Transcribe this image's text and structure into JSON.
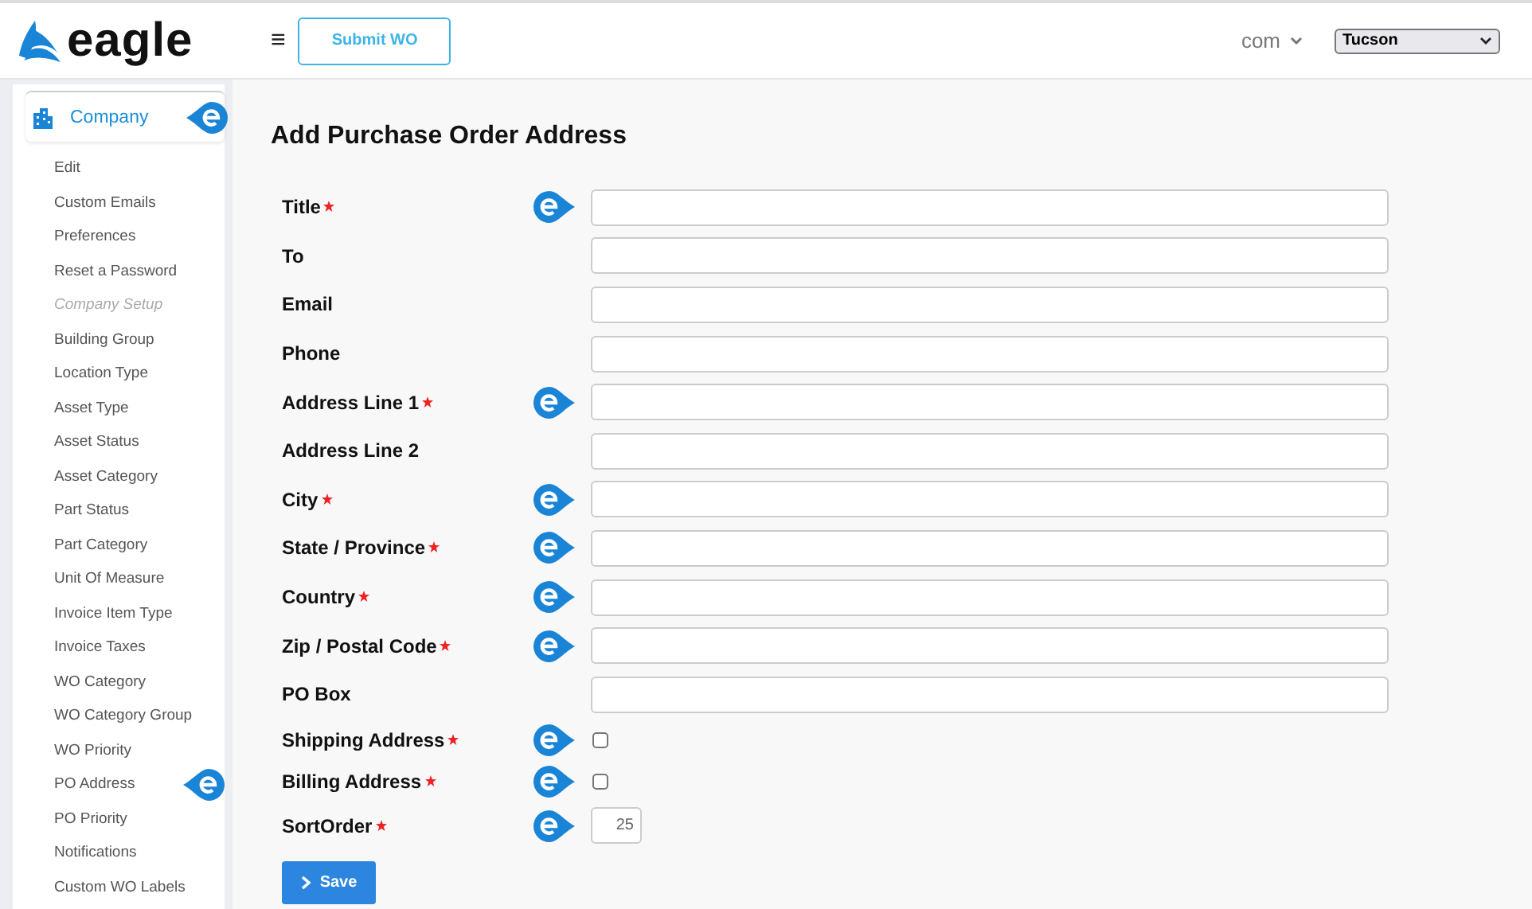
{
  "header": {
    "logo": "eagle",
    "menu_glyph": "≡",
    "submit_button": "Submit WO",
    "account": "com",
    "location": "Tucson"
  },
  "sidebar": {
    "section": {
      "label": "Company",
      "help": true
    },
    "items": [
      {
        "kind": "link",
        "label": "Edit",
        "help": false
      },
      {
        "kind": "link",
        "label": "Custom Emails",
        "help": false
      },
      {
        "kind": "link",
        "label": "Preferences",
        "help": false
      },
      {
        "kind": "link",
        "label": "Reset a Password",
        "help": false
      },
      {
        "kind": "heading",
        "label": "Company Setup",
        "help": false
      },
      {
        "kind": "link",
        "label": "Building Group",
        "help": false
      },
      {
        "kind": "link",
        "label": "Location Type",
        "help": false
      },
      {
        "kind": "link",
        "label": "Asset Type",
        "help": false
      },
      {
        "kind": "link",
        "label": "Asset Status",
        "help": false
      },
      {
        "kind": "link",
        "label": "Asset Category",
        "help": false
      },
      {
        "kind": "link",
        "label": "Part Status",
        "help": false
      },
      {
        "kind": "link",
        "label": "Part Category",
        "help": false
      },
      {
        "kind": "link",
        "label": "Unit Of Measure",
        "help": false
      },
      {
        "kind": "link",
        "label": "Invoice Item Type",
        "help": false
      },
      {
        "kind": "link",
        "label": "Invoice Taxes",
        "help": false
      },
      {
        "kind": "link",
        "label": "WO Category",
        "help": false
      },
      {
        "kind": "link",
        "label": "WO Category Group",
        "help": false
      },
      {
        "kind": "link",
        "label": "WO Priority",
        "help": false
      },
      {
        "kind": "link",
        "label": "PO Address",
        "help": true
      },
      {
        "kind": "link",
        "label": "PO Priority",
        "help": false
      },
      {
        "kind": "link",
        "label": "Notifications",
        "help": false
      },
      {
        "kind": "link",
        "label": "Custom WO Labels",
        "help": false
      }
    ]
  },
  "form": {
    "title": "Add Purchase Order Address",
    "fields": [
      {
        "kind": "text",
        "label": "Title",
        "required": true,
        "help": true
      },
      {
        "kind": "text",
        "label": "To",
        "required": false,
        "help": false
      },
      {
        "kind": "text",
        "label": "Email",
        "required": false,
        "help": false
      },
      {
        "kind": "text",
        "label": "Phone",
        "required": false,
        "help": false
      },
      {
        "kind": "text",
        "label": "Address Line 1",
        "required": true,
        "help": true
      },
      {
        "kind": "text",
        "label": "Address Line 2",
        "required": false,
        "help": false
      },
      {
        "kind": "text",
        "label": "City",
        "required": true,
        "help": true
      },
      {
        "kind": "text",
        "label": "State / Province",
        "required": true,
        "help": true
      },
      {
        "kind": "text",
        "label": "Country",
        "required": true,
        "help": true
      },
      {
        "kind": "text",
        "label": "Zip / Postal Code",
        "required": true,
        "help": true
      },
      {
        "kind": "text",
        "label": "PO Box",
        "required": false,
        "help": false
      },
      {
        "kind": "checkbox",
        "label": "Shipping Address",
        "required": true,
        "help": true,
        "checked": false
      },
      {
        "kind": "checkbox",
        "label": "Billing Address",
        "required": true,
        "help": true,
        "checked": false
      },
      {
        "kind": "number",
        "label": "SortOrder",
        "required": true,
        "help": true,
        "value": "25"
      }
    ],
    "save_button": "Save"
  }
}
